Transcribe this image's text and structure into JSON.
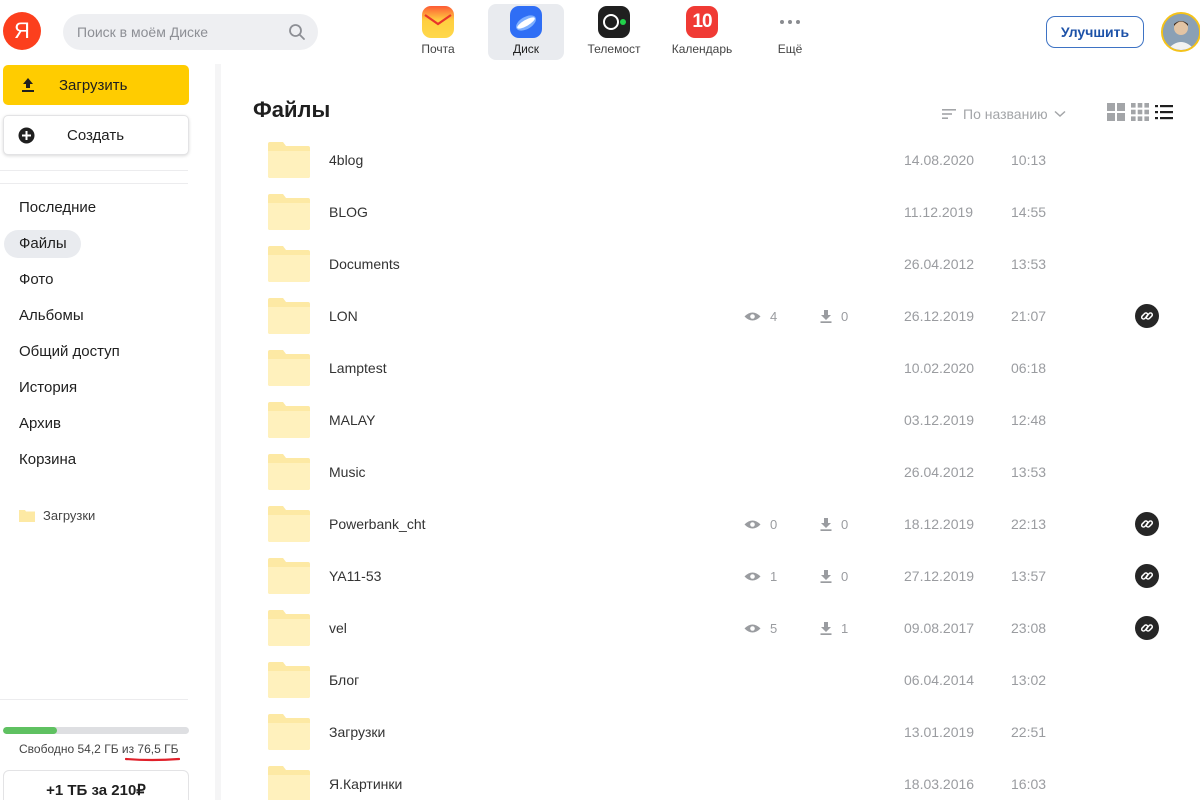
{
  "header": {
    "logo_text": "Я",
    "search": {
      "placeholder": "Поиск в моём Диске",
      "value": ""
    },
    "services": [
      {
        "id": "mail",
        "label": "Почта",
        "icon": "mail-icon"
      },
      {
        "id": "disk",
        "label": "Диск",
        "icon": "disk-icon",
        "active": true
      },
      {
        "id": "telemost",
        "label": "Телемост",
        "icon": "telemost-icon"
      },
      {
        "id": "calendar",
        "label": "Календарь",
        "icon": "calendar-icon",
        "badge": "10"
      },
      {
        "id": "more",
        "label": "Ещё",
        "icon": "more-dots-icon"
      }
    ],
    "upgrade_label": "Улучшить"
  },
  "sidebar": {
    "upload_label": "Загрузить",
    "create_label": "Создать",
    "nav": [
      {
        "label": "Последние"
      },
      {
        "label": "Файлы",
        "active": true
      },
      {
        "label": "Фото"
      },
      {
        "label": "Альбомы"
      },
      {
        "label": "Общий доступ"
      },
      {
        "label": "История"
      },
      {
        "label": "Архив"
      },
      {
        "label": "Корзина"
      }
    ],
    "folder_link": "Загрузки",
    "quota": {
      "used_fraction": 0.29,
      "text": "Свободно 54,2 ГБ из 76,5 ГБ"
    },
    "promo_label": "+1 ТБ за 210₽"
  },
  "main": {
    "title": "Файлы",
    "sort_label": "По названию",
    "view_modes": [
      "large-tiles",
      "small-tiles",
      "list"
    ],
    "active_view": "list",
    "files": [
      {
        "name": "4blog",
        "date": "14.08.2020",
        "time": "10:13"
      },
      {
        "name": "BLOG",
        "date": "11.12.2019",
        "time": "14:55"
      },
      {
        "name": "Documents",
        "date": "26.04.2012",
        "time": "13:53"
      },
      {
        "name": "LON",
        "views": "4",
        "downloads": "0",
        "date": "26.12.2019",
        "time": "21:07",
        "shared": true
      },
      {
        "name": "Lamptest",
        "date": "10.02.2020",
        "time": "06:18"
      },
      {
        "name": "MALAY",
        "date": "03.12.2019",
        "time": "12:48"
      },
      {
        "name": "Music",
        "date": "26.04.2012",
        "time": "13:53"
      },
      {
        "name": "Powerbank_cht",
        "views": "0",
        "downloads": "0",
        "date": "18.12.2019",
        "time": "22:13",
        "shared": true
      },
      {
        "name": "YA11-53",
        "views": "1",
        "downloads": "0",
        "date": "27.12.2019",
        "time": "13:57",
        "shared": true
      },
      {
        "name": "vel",
        "views": "5",
        "downloads": "1",
        "date": "09.08.2017",
        "time": "23:08",
        "shared": true
      },
      {
        "name": "Блог",
        "date": "06.04.2014",
        "time": "13:02"
      },
      {
        "name": "Загрузки",
        "date": "13.01.2019",
        "time": "22:51"
      },
      {
        "name": "Я.Картинки",
        "date": "18.03.2016",
        "time": "16:03"
      }
    ]
  },
  "colors": {
    "accent_yellow": "#ffcc00",
    "folder": "#fde9a4",
    "quota_green": "#5fc161",
    "upgrade_blue": "#1d52a8"
  }
}
